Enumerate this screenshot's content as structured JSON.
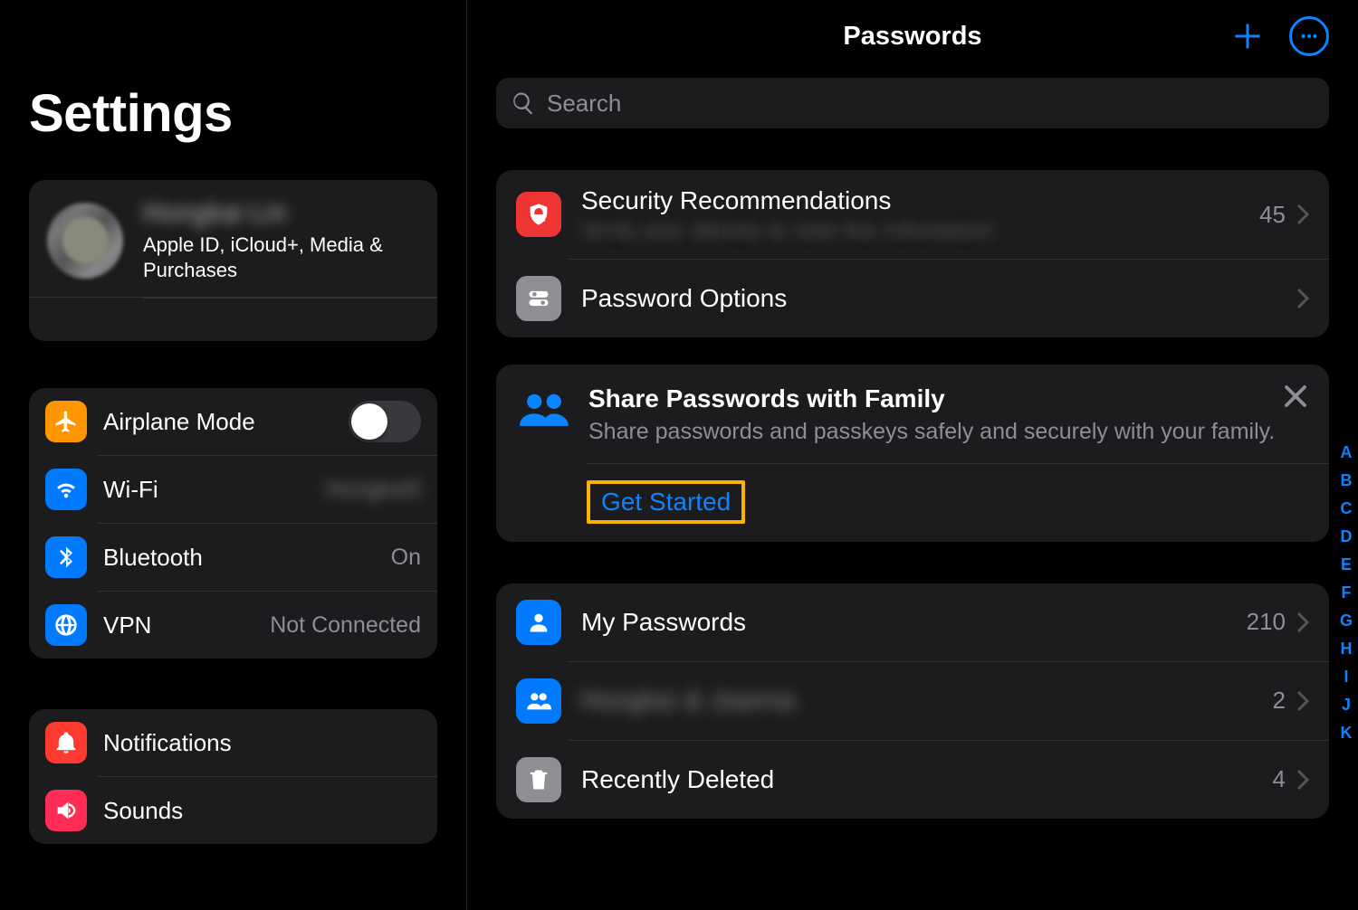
{
  "sidebar": {
    "title": "Settings",
    "profile": {
      "name_obscured": "Hongkai Lin",
      "subtitle": "Apple ID, iCloud+, Media & Purchases"
    },
    "items": {
      "airplane": {
        "label": "Airplane Mode"
      },
      "wifi": {
        "label": "Wi-Fi",
        "value_obscured": "Hongkai5"
      },
      "bluetooth": {
        "label": "Bluetooth",
        "value": "On"
      },
      "vpn": {
        "label": "VPN",
        "value": "Not Connected"
      },
      "notifications": {
        "label": "Notifications"
      },
      "sounds": {
        "label": "Sounds"
      }
    }
  },
  "main": {
    "title": "Passwords",
    "search_placeholder": "Search",
    "security": {
      "title": "Security Recommendations",
      "subtitle_obscured": "Verify your identity to view this information",
      "count": "45"
    },
    "password_options": {
      "label": "Password Options"
    },
    "promo": {
      "title": "Share Passwords with Family",
      "subtitle": "Share passwords and passkeys safely and securely with your family.",
      "action": "Get Started"
    },
    "lists": {
      "my_passwords": {
        "label": "My Passwords",
        "count": "210"
      },
      "shared_group": {
        "label_obscured": "Hongkai & Joanna",
        "count": "2"
      },
      "recently_deleted": {
        "label": "Recently Deleted",
        "count": "4"
      }
    },
    "index_letters": [
      "A",
      "B",
      "C",
      "D",
      "E",
      "F",
      "G",
      "H",
      "I",
      "J",
      "K"
    ]
  }
}
